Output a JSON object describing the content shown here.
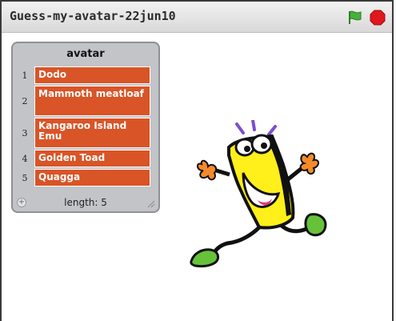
{
  "window": {
    "title": "Guess-my-avatar-22jun10",
    "flag_icon": "green-flag-icon",
    "stop_icon": "stop-sign-icon"
  },
  "list_watcher": {
    "title": "avatar",
    "items": [
      {
        "index": "1",
        "value": "Dodo"
      },
      {
        "index": "2",
        "value": "Mammoth meatloaf"
      },
      {
        "index": "3",
        "value": "Kangaroo Island Emu"
      },
      {
        "index": "4",
        "value": "Golden Toad"
      },
      {
        "index": "5",
        "value": "Quagga"
      }
    ],
    "length_label": "length: 5",
    "add_icon": "plus-icon",
    "resize_icon": "resize-grip-icon"
  },
  "sprite": {
    "name": "cartoon-character"
  },
  "colors": {
    "list_cell": "#d95426",
    "watcher_bg": "#c2c4c8",
    "flag": "#47b03a",
    "stop": "#e0171c"
  }
}
